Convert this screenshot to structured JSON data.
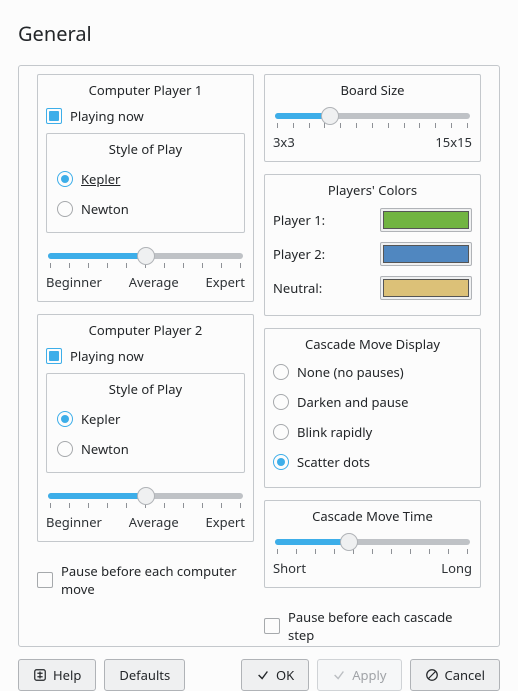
{
  "title": "General",
  "cp1": {
    "legend": "Computer Player 1",
    "playing_now": "Playing now",
    "style_legend": "Style of Play",
    "kepler": "Kepler",
    "newton": "Newton",
    "slider": {
      "min": "Beginner",
      "mid": "Average",
      "max": "Expert",
      "position_pct": 50,
      "ticks": 11
    }
  },
  "cp2": {
    "legend": "Computer Player 2",
    "playing_now": "Playing now",
    "style_legend": "Style of Play",
    "kepler": "Kepler",
    "newton": "Newton",
    "slider": {
      "min": "Beginner",
      "mid": "Average",
      "max": "Expert",
      "position_pct": 50,
      "ticks": 11
    }
  },
  "board": {
    "legend": "Board Size",
    "min": "3x3",
    "max": "15x15",
    "position_pct": 28,
    "ticks": 13
  },
  "colors": {
    "legend": "Players' Colors",
    "p1_label": "Player 1:",
    "p2_label": "Player 2:",
    "neutral_label": "Neutral:",
    "p1_color": "#71b441",
    "p2_color": "#5087c0",
    "neutral_color": "#dcc178"
  },
  "cascade_display": {
    "legend": "Cascade Move Display",
    "none": "None (no pauses)",
    "darken": "Darken and pause",
    "blink": "Blink rapidly",
    "scatter": "Scatter dots",
    "selected": "scatter"
  },
  "cascade_time": {
    "legend": "Cascade Move Time",
    "min": "Short",
    "max": "Long",
    "position_pct": 38,
    "ticks": 11
  },
  "bottom": {
    "pause_computer": "Pause before each computer move",
    "pause_cascade": "Pause before each cascade step"
  },
  "buttons": {
    "help": "Help",
    "defaults": "Defaults",
    "ok": "OK",
    "apply": "Apply",
    "cancel": "Cancel"
  }
}
